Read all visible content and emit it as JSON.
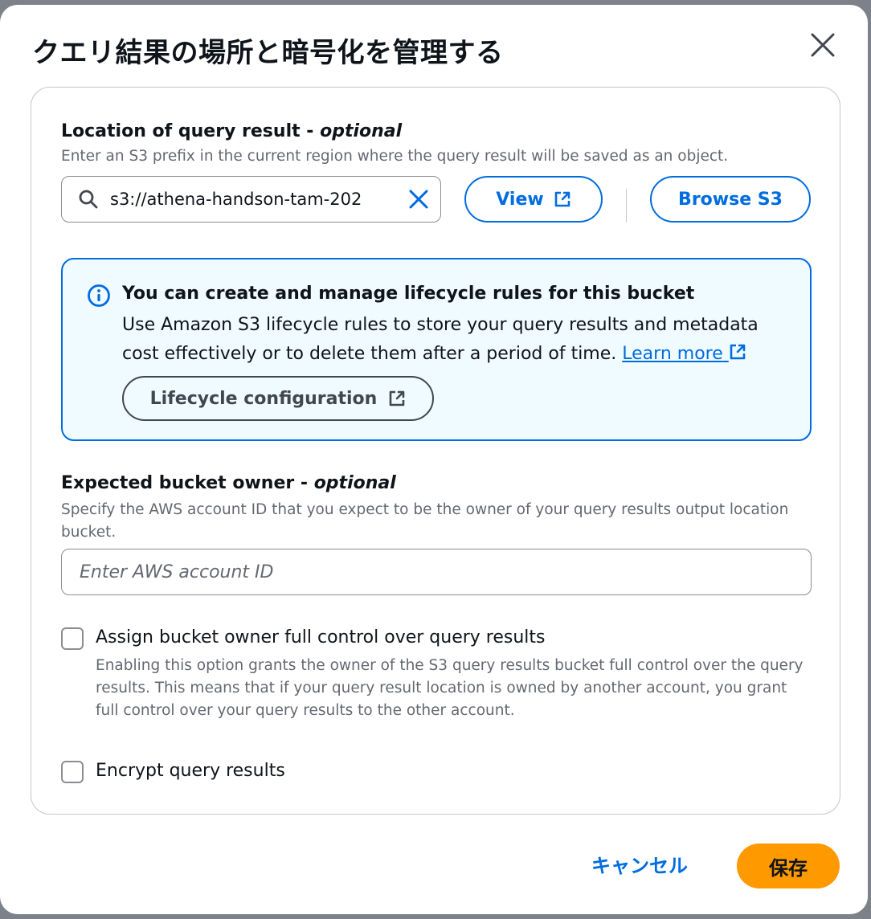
{
  "dialog": {
    "title": "クエリ結果の場所と暗号化を管理する"
  },
  "location": {
    "label": "Location of query result - ",
    "label_optional": "optional",
    "description": "Enter an S3 prefix in the current region where the query result will be saved as an object.",
    "value": "s3://athena-handson-tam-202",
    "view_label": "View",
    "browse_label": "Browse S3"
  },
  "info_alert": {
    "title": "You can create and manage lifecycle rules for this bucket",
    "body": "Use Amazon S3 lifecycle rules to store your query results and metadata cost effectively or to delete them after a period of time.",
    "learn_more": "Learn more",
    "button_label": "Lifecycle configuration"
  },
  "owner": {
    "label": "Expected bucket owner - ",
    "label_optional": "optional",
    "description": "Specify the AWS account ID that you expect to be the owner of your query results output location bucket.",
    "placeholder": "Enter AWS account ID",
    "value": ""
  },
  "full_control": {
    "label": "Assign bucket owner full control over query results",
    "description": "Enabling this option grants the owner of the S3 query results bucket full control over the query results. This means that if your query result location is owned by another account, you grant full control over your query results to the other account.",
    "checked": false
  },
  "encrypt": {
    "label": "Encrypt query results",
    "checked": false
  },
  "footer": {
    "cancel_label": "キャンセル",
    "save_label": "保存"
  },
  "colors": {
    "accent": "#006ce0",
    "primary_button": "#ff9900",
    "info_background": "#f0fbff"
  },
  "icons": [
    "close-icon",
    "search-icon",
    "clear-icon",
    "external-link-icon",
    "info-icon"
  ]
}
